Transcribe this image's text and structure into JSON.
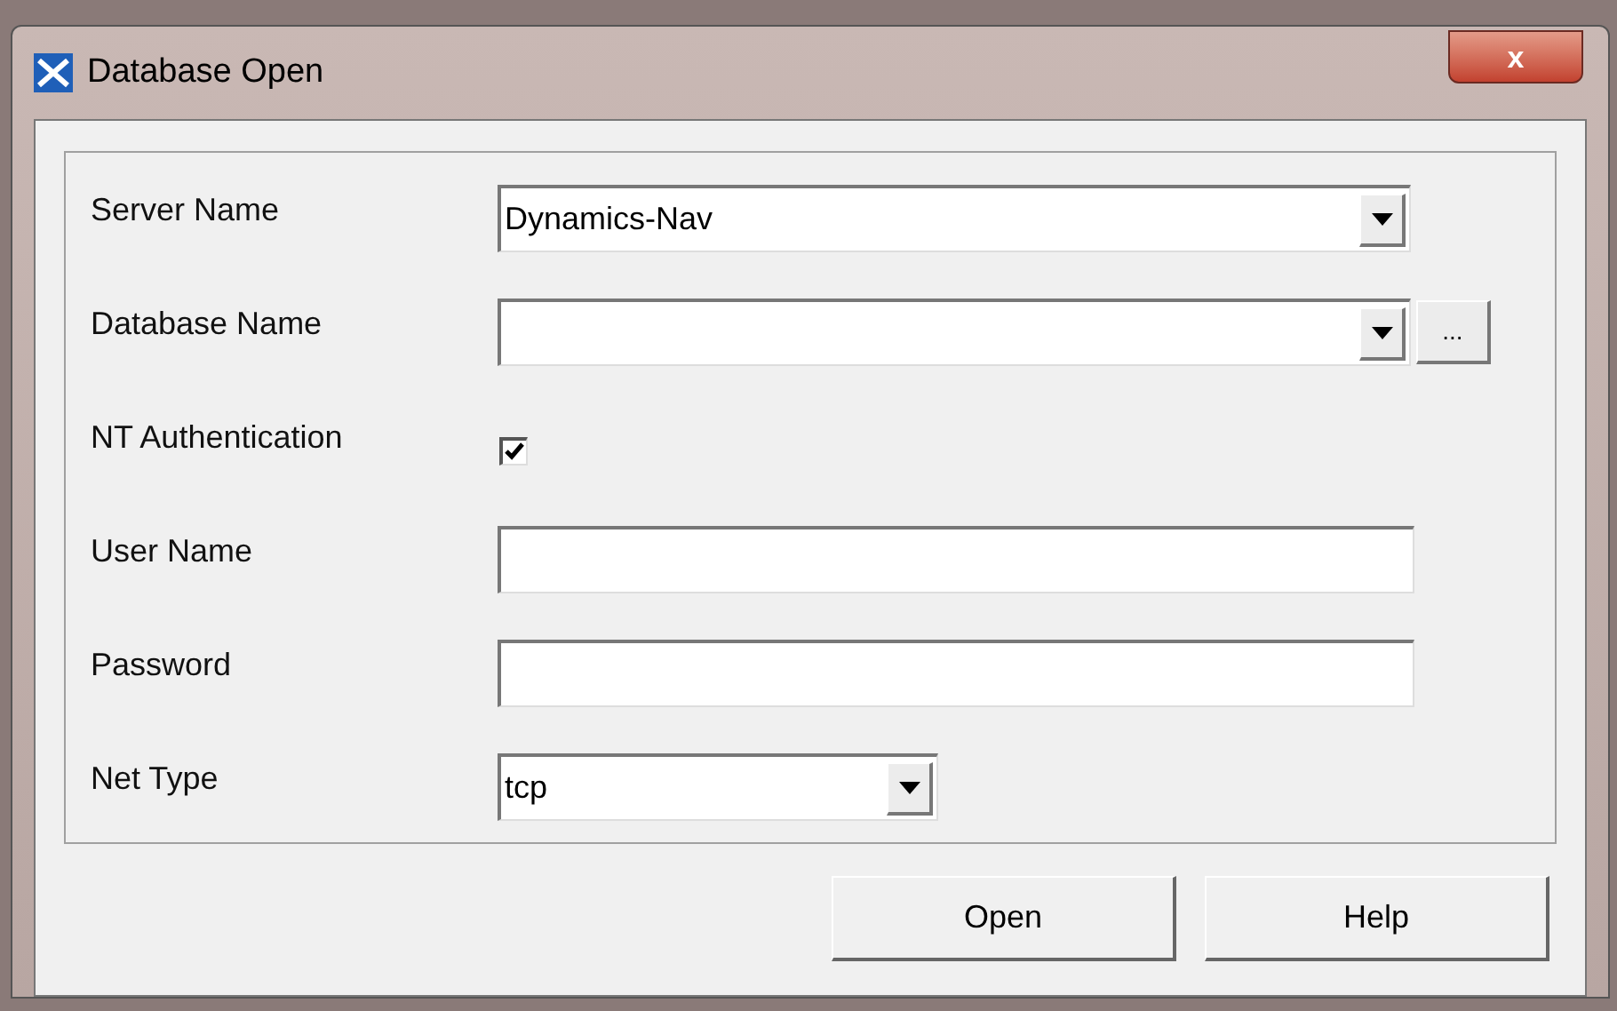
{
  "window": {
    "title": "Database Open",
    "close": "x"
  },
  "fields": [
    {
      "kind": "combo",
      "label": "Server Name",
      "value": "Dynamics-Nav"
    },
    {
      "kind": "combo_browse",
      "label": "Database Name",
      "browse": "..."
    },
    {
      "kind": "checkbox",
      "label": "NT Authentication",
      "checked": true
    },
    {
      "kind": "text",
      "label": "User Name"
    },
    {
      "kind": "text",
      "label": "Password"
    },
    {
      "kind": "combo_short",
      "label": "Net Type",
      "value": "tcp"
    }
  ],
  "buttons": [
    "Open",
    "Help"
  ]
}
